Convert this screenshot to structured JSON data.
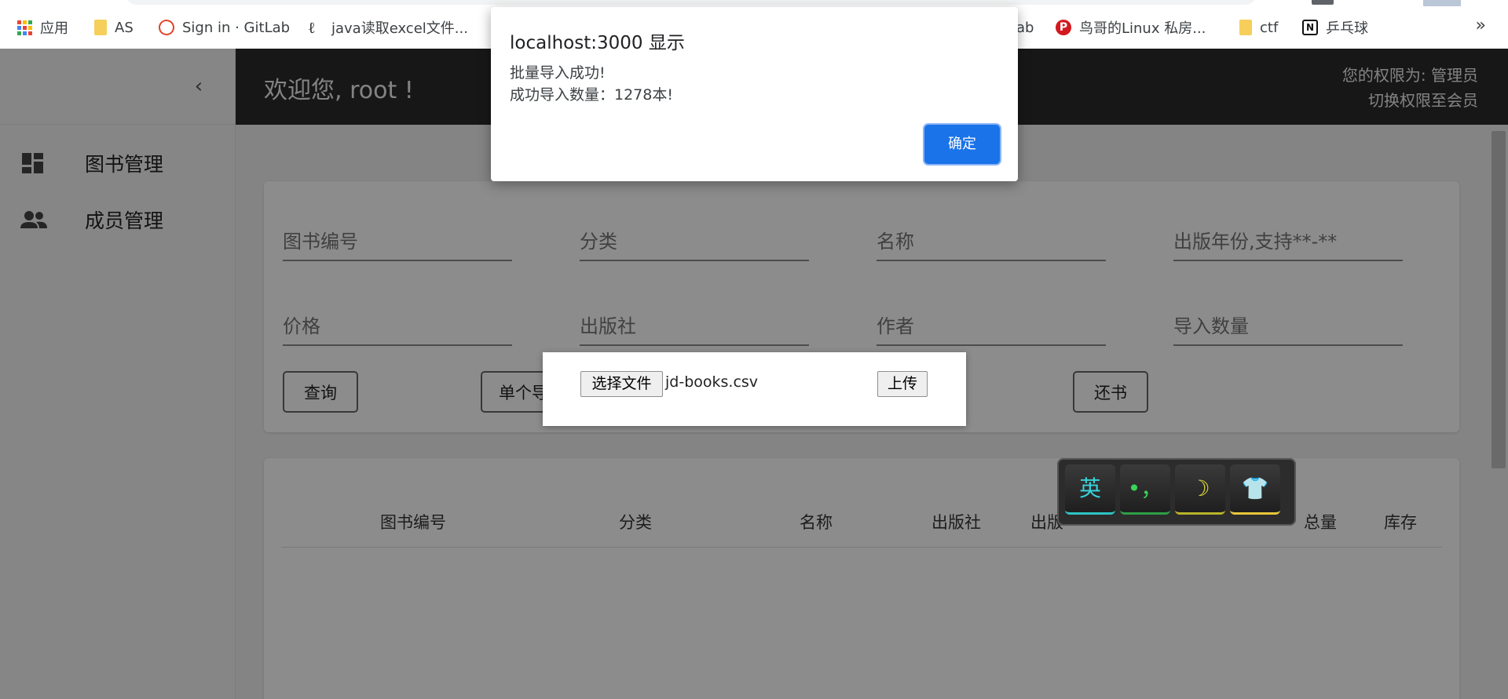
{
  "bookmarks": {
    "items": [
      {
        "label": "应用",
        "icon": "apps-grid-icon"
      },
      {
        "label": "AS",
        "icon": "folder-icon"
      },
      {
        "label": "Sign in · GitLab",
        "icon": "gitlab-icon"
      },
      {
        "label": "java读取excel文件...",
        "icon": "java-icon"
      },
      {
        "label": "ab",
        "icon": "none"
      },
      {
        "label": "鸟哥的Linux 私房...",
        "icon": "p-logo-icon"
      },
      {
        "label": "ctf",
        "icon": "folder-icon"
      },
      {
        "label": "乒乓球",
        "icon": "notion-icon"
      }
    ],
    "more": "»"
  },
  "sidebar": {
    "collapse_icon": "‹",
    "items": [
      {
        "label": "图书管理",
        "icon": "dashboard-icon"
      },
      {
        "label": "成员管理",
        "icon": "people-icon"
      }
    ]
  },
  "header": {
    "welcome": "欢迎您, root !",
    "permission": "您的权限为: 管理员",
    "switch": "切换权限至会员"
  },
  "search": {
    "fields": [
      "图书编号",
      "分类",
      "名称",
      "出版年份,支持**-**",
      "价格",
      "出版社",
      "作者",
      "导入数量"
    ],
    "buttons": {
      "query": "查询",
      "single_import": "单个导入",
      "return": "还书"
    }
  },
  "table": {
    "headers": [
      "图书编号",
      "分类",
      "名称",
      "出版社",
      "出版",
      "总量",
      "库存"
    ]
  },
  "upload": {
    "choose_file": "选择文件",
    "file_name": "jd-books.csv",
    "upload": "上传"
  },
  "ime": {
    "keys": [
      "英",
      "•，",
      "☽",
      "👕"
    ]
  },
  "alert": {
    "title": "localhost:3000 显示",
    "line1": "批量导入成功!",
    "line2": "成功导入数量：1278本!",
    "ok": "确定"
  },
  "colors": {
    "header_bg": "#2b2b2b",
    "alert_button": "#1a73e8"
  }
}
